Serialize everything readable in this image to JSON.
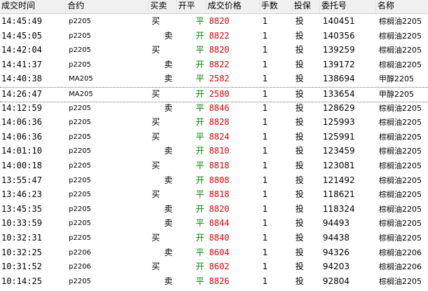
{
  "headers": {
    "time": "成交时间",
    "contract": "合约",
    "direction": "买卖",
    "offset": "开平",
    "price": "成交价格",
    "qty": "手数",
    "hedge": "投保",
    "order_no": "委托号",
    "name": "名称"
  },
  "rows": [
    {
      "time": "14:45:49",
      "contract": "p2205",
      "direction": "买",
      "offset": "平",
      "price": "8820",
      "qty": "1",
      "hedge": "投",
      "order_no": "140451",
      "name": "棕榈油2205"
    },
    {
      "time": "14:45:05",
      "contract": "p2205",
      "direction": "卖",
      "offset": "开",
      "price": "8822",
      "qty": "1",
      "hedge": "投",
      "order_no": "140356",
      "name": "棕榈油2205"
    },
    {
      "time": "14:42:04",
      "contract": "p2205",
      "direction": "买",
      "offset": "平",
      "price": "8820",
      "qty": "1",
      "hedge": "投",
      "order_no": "139259",
      "name": "棕榈油2205"
    },
    {
      "time": "14:41:37",
      "contract": "p2205",
      "direction": "卖",
      "offset": "开",
      "price": "8822",
      "qty": "1",
      "hedge": "投",
      "order_no": "139172",
      "name": "棕榈油2205"
    },
    {
      "time": "14:40:38",
      "contract": "MA205",
      "direction": "卖",
      "offset": "平",
      "price": "2582",
      "qty": "1",
      "hedge": "投",
      "order_no": "138694",
      "name": "甲醇2205"
    },
    {
      "time": "14:26:47",
      "contract": "MA205",
      "direction": "买",
      "offset": "开",
      "price": "2580",
      "qty": "1",
      "hedge": "投",
      "order_no": "133654",
      "name": "甲醇2205",
      "selected": true
    },
    {
      "time": "14:12:59",
      "contract": "p2205",
      "direction": "卖",
      "offset": "平",
      "price": "8846",
      "qty": "1",
      "hedge": "投",
      "order_no": "128629",
      "name": "棕榈油2205"
    },
    {
      "time": "14:06:36",
      "contract": "p2205",
      "direction": "买",
      "offset": "开",
      "price": "8828",
      "qty": "1",
      "hedge": "投",
      "order_no": "125993",
      "name": "棕榈油2205"
    },
    {
      "time": "14:06:36",
      "contract": "p2205",
      "direction": "买",
      "offset": "平",
      "price": "8824",
      "qty": "1",
      "hedge": "投",
      "order_no": "125991",
      "name": "棕榈油2205"
    },
    {
      "time": "14:01:10",
      "contract": "p2205",
      "direction": "卖",
      "offset": "开",
      "price": "8810",
      "qty": "1",
      "hedge": "投",
      "order_no": "123459",
      "name": "棕榈油2205"
    },
    {
      "time": "14:00:18",
      "contract": "p2205",
      "direction": "买",
      "offset": "平",
      "price": "8818",
      "qty": "1",
      "hedge": "投",
      "order_no": "123081",
      "name": "棕榈油2205"
    },
    {
      "time": "13:55:47",
      "contract": "p2205",
      "direction": "卖",
      "offset": "开",
      "price": "8808",
      "qty": "1",
      "hedge": "投",
      "order_no": "121492",
      "name": "棕榈油2205"
    },
    {
      "time": "13:46:23",
      "contract": "p2205",
      "direction": "买",
      "offset": "平",
      "price": "8818",
      "qty": "1",
      "hedge": "投",
      "order_no": "118621",
      "name": "棕榈油2205"
    },
    {
      "time": "13:45:35",
      "contract": "p2205",
      "direction": "卖",
      "offset": "开",
      "price": "8820",
      "qty": "1",
      "hedge": "投",
      "order_no": "118324",
      "name": "棕榈油2205"
    },
    {
      "time": "10:33:59",
      "contract": "p2205",
      "direction": "卖",
      "offset": "平",
      "price": "8844",
      "qty": "1",
      "hedge": "投",
      "order_no": "94493",
      "name": "棕榈油2205"
    },
    {
      "time": "10:32:31",
      "contract": "p2205",
      "direction": "买",
      "offset": "开",
      "price": "8840",
      "qty": "1",
      "hedge": "投",
      "order_no": "94438",
      "name": "棕榈油2205"
    },
    {
      "time": "10:32:25",
      "contract": "p2206",
      "direction": "卖",
      "offset": "平",
      "price": "8604",
      "qty": "1",
      "hedge": "投",
      "order_no": "94326",
      "name": "棕榈油2206"
    },
    {
      "time": "10:31:52",
      "contract": "p2206",
      "direction": "买",
      "offset": "开",
      "price": "8602",
      "qty": "1",
      "hedge": "投",
      "order_no": "94203",
      "name": "棕榈油2206"
    },
    {
      "time": "10:14:25",
      "contract": "p2205",
      "direction": "卖",
      "offset": "平",
      "price": "8826",
      "qty": "1",
      "hedge": "投",
      "order_no": "92804",
      "name": "棕榈油2205"
    }
  ]
}
